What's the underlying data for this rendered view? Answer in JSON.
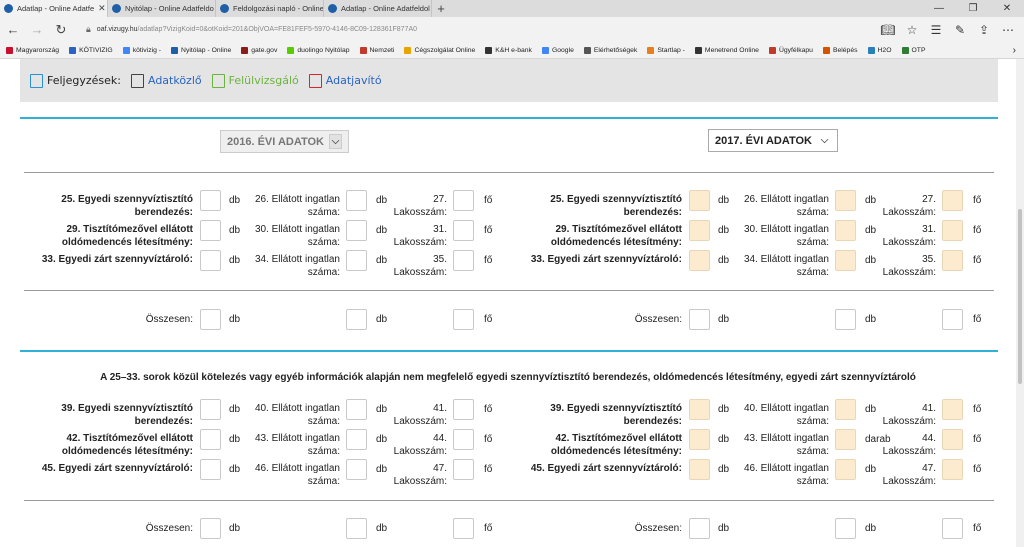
{
  "browser": {
    "tabs": [
      {
        "label": "Adatlap - Online Adatfe",
        "active": true
      },
      {
        "label": "Nyitólap - Online Adatfeldo",
        "active": false
      },
      {
        "label": "Feldolgozási napló - Online",
        "active": false
      },
      {
        "label": "Adatlap - Online Adatfeldol",
        "active": false
      }
    ],
    "url_host": "oaf.vizugy.hu",
    "url_rest": "/adatlap?VizigKoid=0&otKoid=201&ObjVOA=FE81FEF5-5970-4146-8C09-128361F877A0",
    "favorites": [
      {
        "label": "Magyarország",
        "color": "#c8102e"
      },
      {
        "label": "KÖTIVIZIG",
        "color": "#2a63c2"
      },
      {
        "label": "kötivizig -",
        "color": "#4285f4"
      },
      {
        "label": "Nyitólap - Online",
        "color": "#1f5fa8"
      },
      {
        "label": "gate.gov",
        "color": "#8a1c1c"
      },
      {
        "label": "duolingo Nyitólap",
        "color": "#58cc02"
      },
      {
        "label": "Nemzeti",
        "color": "#c0392b"
      },
      {
        "label": "Cégszolgálat Online",
        "color": "#e8a400"
      },
      {
        "label": "K&H e-bank",
        "color": "#333333"
      },
      {
        "label": "Google",
        "color": "#4285f4"
      },
      {
        "label": "Elérhetőségek",
        "color": "#555555"
      },
      {
        "label": "Startlap -",
        "color": "#e67e22"
      },
      {
        "label": "Menetrend Online",
        "color": "#333333"
      },
      {
        "label": "Ügyfélkapu",
        "color": "#c0392b"
      },
      {
        "label": "Belépés",
        "color": "#d35400"
      },
      {
        "label": "H2O",
        "color": "#2980b9"
      },
      {
        "label": "OTP",
        "color": "#2e7d32"
      }
    ]
  },
  "toolbar": {
    "label": "Feljegyzések:",
    "link1": "Adatközlő",
    "link2": "Felülvizsgáló",
    "link3": "Adatjavító"
  },
  "years": {
    "left": "2016. ÉVI ADATOK",
    "right": "2017. ÉVI ADATOK"
  },
  "units": {
    "db": "db",
    "fo": "fő",
    "darab": "darab"
  },
  "section1": {
    "r1": {
      "a": "25. Egyedi szennyvíztisztító berendezés:",
      "b": "26. Ellátott ingatlan száma:",
      "c": "27. Lakosszám:"
    },
    "r2": {
      "a": "29. Tisztítómezővel ellátott oldómedencés létesítmény:",
      "b": "30. Ellátott ingatlan száma:",
      "c": "31. Lakosszám:"
    },
    "r3": {
      "a": "33. Egyedi zárt szennyvíztároló:",
      "b": "34. Ellátott ingatlan száma:",
      "c": "35. Lakosszám:"
    }
  },
  "total_label": "Összesen:",
  "section2_title": "A 25–33. sorok közül kötelezés vagy egyéb információk alapján nem megfelelő egyedi szennyvíztisztító berendezés, oldómedencés létesítmény, egyedi zárt szennyvíztároló",
  "section2": {
    "r1": {
      "a": "39. Egyedi szennyvíztisztító berendezés:",
      "b": "40. Ellátott ingatlan száma:",
      "c": "41. Lakosszám:"
    },
    "r2": {
      "a": "42. Tisztítómezővel ellátott oldómedencés létesítmény:",
      "b": "43. Ellátott ingatlan száma:",
      "c": "44. Lakosszám:"
    },
    "r3": {
      "a": "45. Egyedi zárt szennyvíztároló:",
      "b": "46. Ellátott ingatlan száma:",
      "c": "47. Lakosszám:"
    }
  }
}
